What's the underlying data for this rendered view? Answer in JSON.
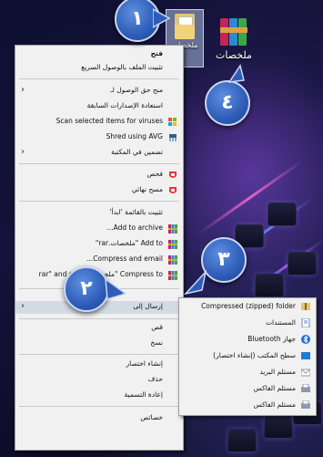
{
  "desktop": {
    "folder_label": "ملخصات",
    "rar_label": "ملخصات"
  },
  "menu": {
    "items": [
      {
        "label": "فتح",
        "bold": true
      },
      {
        "label": "تثبيت الملف بالوصول السريع"
      },
      {
        "label": "منح حق الوصول لـ",
        "submenu": true
      },
      {
        "label": "استعادة الإصدارات السابقة"
      },
      {
        "label": "Scan selected items for viruses",
        "icon": "windows-defender-icon"
      },
      {
        "label": "Shred using AVG",
        "icon": "avg-shred-icon"
      },
      {
        "label": "تضمين في المكتبة",
        "submenu": true
      },
      {
        "label": "فحص",
        "icon": "avg-scan-icon"
      },
      {
        "label": "مسح نهائي",
        "icon": "avg-wipe-icon"
      },
      {
        "label": "تثبيت بالقائمة 'ابدأ'"
      },
      {
        "label": "Add to archive...",
        "icon": "winrar-icon"
      },
      {
        "label": "Add to \"ملخصات.rar\"",
        "icon": "winrar-icon"
      },
      {
        "label": "Compress and email...",
        "icon": "winrar-icon"
      },
      {
        "label": "Compress to \"ملخصات.rar\" and email",
        "icon": "winrar-icon"
      },
      {
        "label": "إرسال إلى",
        "submenu": true
      },
      {
        "label": "قص"
      },
      {
        "label": "نسخ"
      },
      {
        "label": "إنشاء اختصار"
      },
      {
        "label": "حذف"
      },
      {
        "label": "إعادة التسمية"
      },
      {
        "label": "خصائص"
      }
    ]
  },
  "send_to": {
    "items": [
      {
        "label": "Compressed (zipped) folder",
        "icon": "zip-folder-icon"
      },
      {
        "label": "المستندات",
        "icon": "documents-icon"
      },
      {
        "label": "جهاز Bluetooth",
        "icon": "bluetooth-icon"
      },
      {
        "label": "سطح المكتب (إنشاء اختصار)",
        "icon": "desktop-icon"
      },
      {
        "label": "مستلم البريد",
        "icon": "mail-icon"
      },
      {
        "label": "مستلم الفاكس",
        "icon": "fax-icon"
      },
      {
        "label": "مستلم الفاكس",
        "icon": "fax-icon"
      }
    ]
  },
  "badges": [
    "١",
    "٢",
    "٣",
    "٤"
  ],
  "colors": {
    "badge": "#2e5cb8",
    "menu_bg": "#f1f1f1",
    "highlight": "#d4dbe5"
  }
}
